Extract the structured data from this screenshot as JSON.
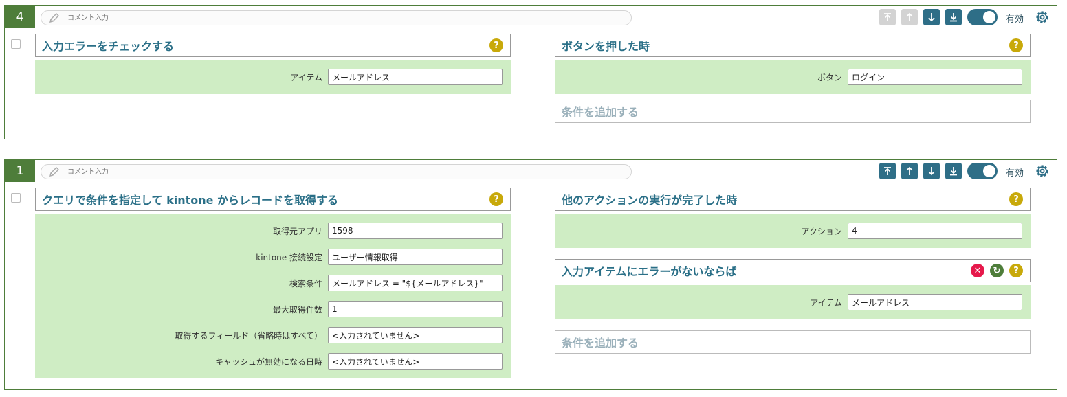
{
  "blocks": [
    {
      "number": "4",
      "comment_placeholder": "コメント入力",
      "toolbar": {
        "top_enabled": false,
        "up_enabled": false,
        "down_enabled": true,
        "bottom_enabled": true,
        "enabled_label": "有効"
      },
      "action": {
        "title": "入力エラーをチェックする",
        "help": "?",
        "fields": [
          {
            "label": "アイテム",
            "value": "メールアドレス"
          }
        ]
      },
      "conditions": [
        {
          "title": "ボタンを押した時",
          "help": "?",
          "fields": [
            {
              "label": "ボタン",
              "value": "ログイン"
            }
          ]
        }
      ],
      "add_condition_label": "条件を追加する"
    },
    {
      "number": "1",
      "comment_placeholder": "コメント入力",
      "toolbar": {
        "top_enabled": true,
        "up_enabled": true,
        "down_enabled": true,
        "bottom_enabled": true,
        "enabled_label": "有効"
      },
      "action": {
        "title": "クエリで条件を指定して kintone からレコードを取得する",
        "help": "?",
        "fields": [
          {
            "label": "取得元アプリ",
            "value": "1598"
          },
          {
            "label": "kintone 接続設定",
            "value": "ユーザー情報取得"
          },
          {
            "label": "検索条件",
            "value": "メールアドレス = \"${メールアドレス}\""
          },
          {
            "label": "最大取得件数",
            "value": "1"
          },
          {
            "label": "取得するフィールド（省略時はすべて）",
            "value": "<入力されていません>"
          },
          {
            "label": "キャッシュが無効になる日時",
            "value": "<入力されていません>"
          }
        ]
      },
      "conditions": [
        {
          "title": "他のアクションの実行が完了した時",
          "help": "?",
          "fields": [
            {
              "label": "アクション",
              "value": "4"
            }
          ]
        },
        {
          "title": "入力アイテムにエラーがないならば",
          "help": "?",
          "remove": "✕",
          "refresh": "↻",
          "fields": [
            {
              "label": "アイテム",
              "value": "メールアドレス"
            }
          ]
        }
      ],
      "add_condition_label": "条件を追加する"
    }
  ],
  "colors": {
    "block_border": "#4e7d3a",
    "accent": "#2e6e87",
    "panel_bg": "#cfedc4",
    "help": "#c8a90a",
    "remove": "#e6194b"
  }
}
